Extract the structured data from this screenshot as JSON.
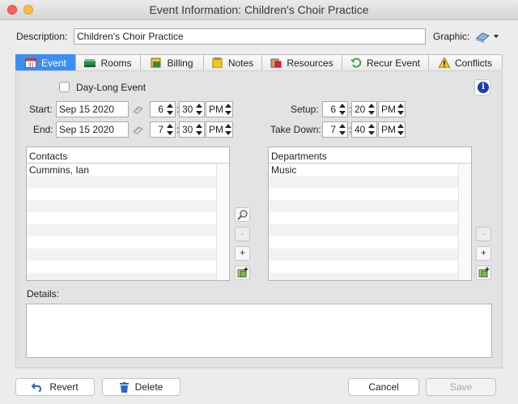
{
  "window": {
    "title": "Event Information: Children's Choir Practice"
  },
  "description": {
    "label": "Description:",
    "value": "Children's Choir Practice"
  },
  "graphic": {
    "label": "Graphic:"
  },
  "tabs": [
    {
      "label": "Event",
      "icon": "calendar-icon"
    },
    {
      "label": "Rooms",
      "icon": "room-icon"
    },
    {
      "label": "Billing",
      "icon": "billing-icon"
    },
    {
      "label": "Notes",
      "icon": "notes-icon"
    },
    {
      "label": "Resources",
      "icon": "resources-icon"
    },
    {
      "label": "Recur Event",
      "icon": "recur-icon"
    },
    {
      "label": "Conflicts",
      "icon": "warning-icon"
    }
  ],
  "event": {
    "day_long_label": "Day-Long Event",
    "start": {
      "label": "Start:",
      "date": "Sep 15 2020",
      "hour": "6",
      "minute": "30",
      "ampm": "PM"
    },
    "end": {
      "label": "End:",
      "date": "Sep 15 2020",
      "hour": "7",
      "minute": "30",
      "ampm": "PM"
    },
    "setup": {
      "label": "Setup:",
      "hour": "6",
      "minute": "20",
      "ampm": "PM"
    },
    "takedown": {
      "label": "Take Down:",
      "hour": "7",
      "minute": "40",
      "ampm": "PM"
    },
    "colon": ":"
  },
  "contacts": {
    "header": "Contacts",
    "rows": [
      "Cummins, Ian"
    ]
  },
  "departments": {
    "header": "Departments",
    "rows": [
      "Music"
    ]
  },
  "buttons": {
    "minus": "-",
    "plus": "+",
    "revert": "Revert",
    "delete": "Delete",
    "cancel": "Cancel",
    "save": "Save"
  },
  "details": {
    "label": "Details:",
    "value": ""
  }
}
